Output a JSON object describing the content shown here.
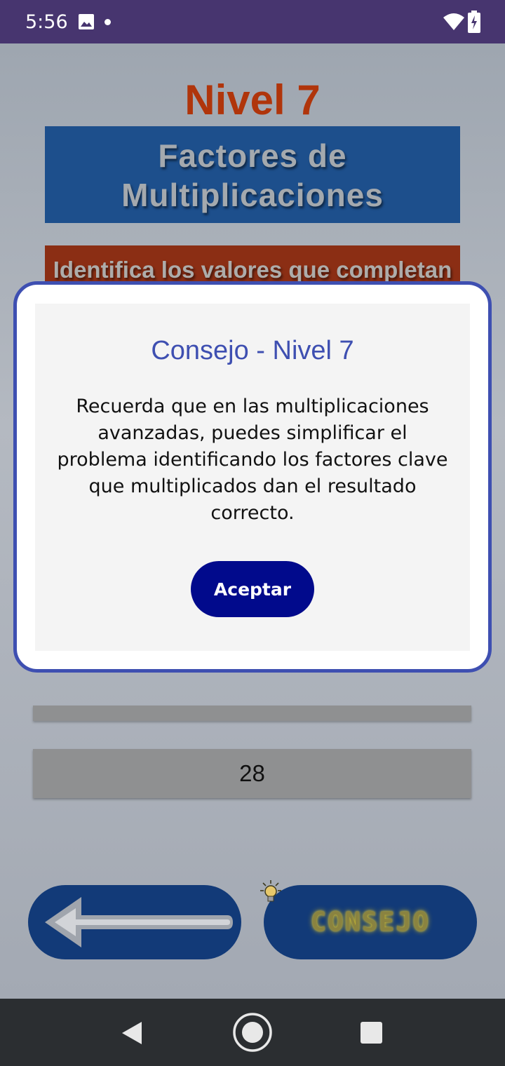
{
  "status_bar": {
    "time": "5:56",
    "icons": [
      "image-icon",
      "notification-dot",
      "wifi-icon",
      "battery-charging-icon"
    ]
  },
  "game": {
    "level_title": "Nivel 7",
    "topic": "Factores de Multiplicaciones",
    "instruction": "Identifica los valores que completan la multiplicación",
    "answer_value": "28",
    "back_button_icon": "arrow-left-icon",
    "hint_button_label": "CONSEJO",
    "hint_button_icon": "lightbulb-icon"
  },
  "dialog": {
    "title": "Consejo - Nivel 7",
    "message": "Recuerda que en las multiplicaciones avanzadas, puedes simplificar el problema identificando los factores clave que multiplicados dan el resultado correcto.",
    "accept_label": "Aceptar"
  },
  "nav_bar": {
    "icons": [
      "back-icon",
      "home-icon",
      "recents-icon"
    ]
  },
  "colors": {
    "status_bar": "#47356f",
    "level_title": "#b0350b",
    "topic_box": "#1d4f8c",
    "instruction_box": "#8b2e14",
    "dialog_border": "#3e4fb1",
    "accept_button": "#010a8c",
    "game_buttons": "#123a78"
  }
}
